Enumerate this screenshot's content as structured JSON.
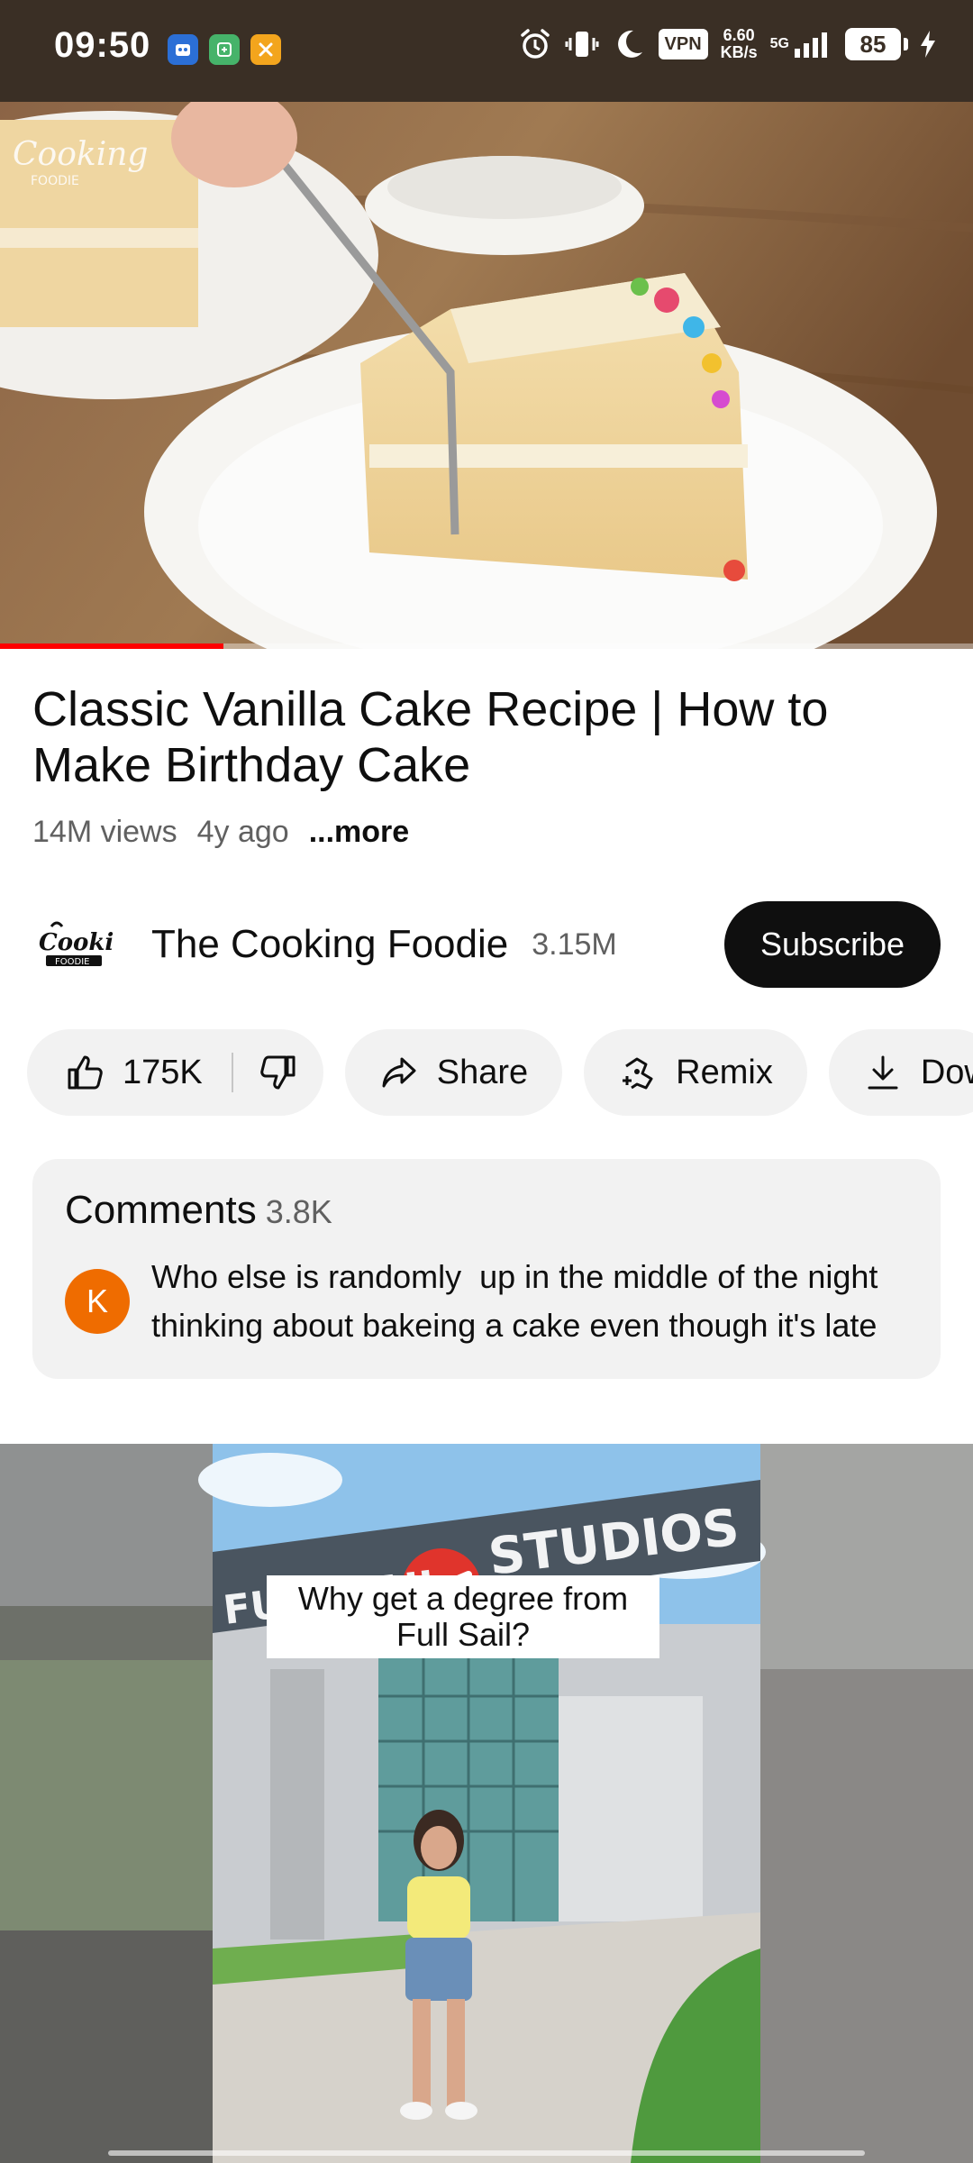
{
  "status_bar": {
    "time": "09:50",
    "vpn": "VPN",
    "net_speed_value": "6.60",
    "net_speed_unit": "KB/s",
    "network": "5G",
    "battery": "85",
    "icons": [
      "app-icon-1",
      "app-icon-2",
      "app-icon-3",
      "alarm-icon",
      "vibrate-icon",
      "moon-icon",
      "signal-icon",
      "charging-icon"
    ]
  },
  "player": {
    "watermark": "Cooking FOODIE",
    "progress_fraction": 0.23
  },
  "video": {
    "title": "Classic Vanilla Cake Recipe | How to Make Birthday Cake",
    "views": "14M views",
    "age": "4y ago",
    "more_label": "...more"
  },
  "channel": {
    "name": "The Cooking Foodie",
    "subscribers": "3.15M",
    "subscribe_label": "Subscribe"
  },
  "actions": {
    "like_count": "175K",
    "share_label": "Share",
    "remix_label": "Remix",
    "download_label": "Dow"
  },
  "comments": {
    "label": "Comments",
    "count": "3.8K",
    "avatar_letter": "K",
    "top_comment": "Who else is randomly  up in the middle of the night thinking about bakeing a cake even though it's late"
  },
  "ad": {
    "sign_left": "FULL SAIL",
    "sign_right": "STUDIOS",
    "caption": "Why get a degree from Full Sail?"
  },
  "colors": {
    "status_bar_bg": "#3a2f25",
    "progress": "#ff0000",
    "avatar": "#ef6c00",
    "pill_bg": "#f2f2f2"
  }
}
